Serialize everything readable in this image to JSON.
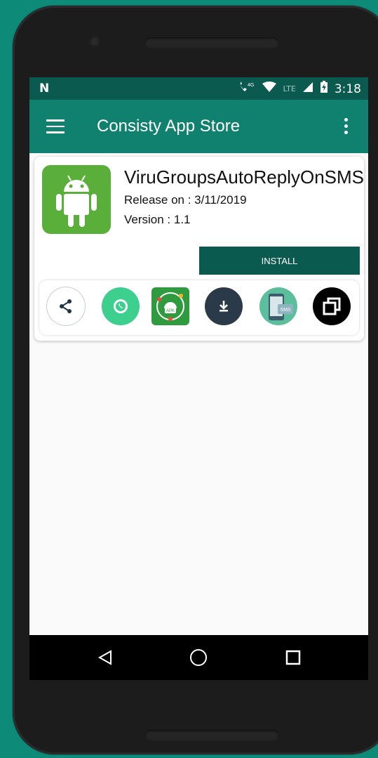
{
  "status": {
    "network_glyph": "N",
    "lte": "LTE",
    "time": "3:18",
    "signal_label": "4G"
  },
  "appbar": {
    "title": "Consisty App Store"
  },
  "app": {
    "name": "ViruGroupsAutoReplyOnSMS",
    "release": "Release on : 3/11/2019",
    "version": "Version : 1.1",
    "install_label": "INSTALL",
    "icon_color": "#5aae3a"
  },
  "actions": [
    {
      "name": "share-icon"
    },
    {
      "name": "whatsapp-icon"
    },
    {
      "name": "apk-icon",
      "text": "APK"
    },
    {
      "name": "download-icon"
    },
    {
      "name": "sms-icon",
      "text": "SMS"
    },
    {
      "name": "copy-icon"
    }
  ],
  "colors": {
    "accent": "#10806f",
    "dark": "#0b5a4f",
    "background": "#0d8a78"
  }
}
